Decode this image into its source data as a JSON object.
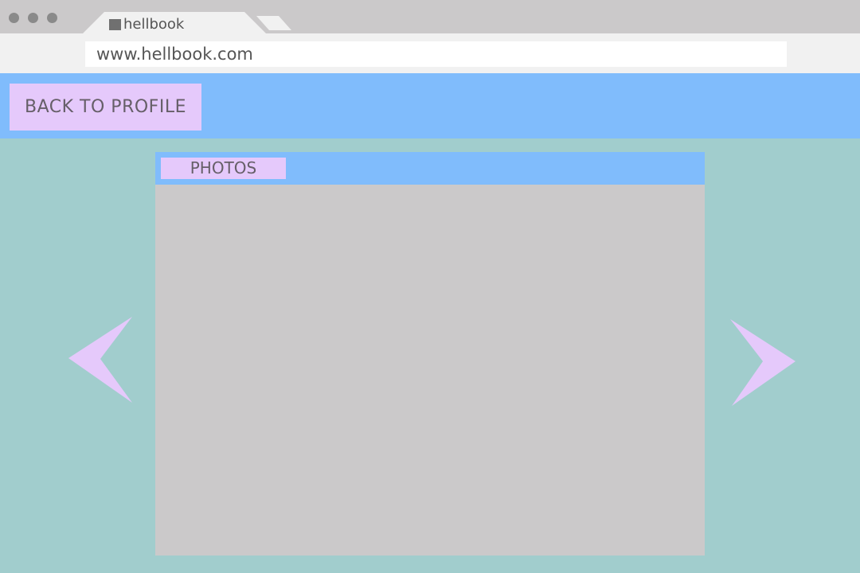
{
  "browser": {
    "tab_title": "hellbook",
    "url": "www.hellbook.com"
  },
  "header": {
    "back_label": "BACK TO PROFILE"
  },
  "photos_panel": {
    "tab_label": "PHOTOS"
  },
  "icons": {
    "previous": "arrow-left-icon",
    "next": "arrow-right-icon",
    "favicon": "favicon-icon"
  },
  "colors": {
    "page_background": "#a1cdcd",
    "header_band": "#80bcfc",
    "button_fill": "#e5c9fb",
    "panel_fill": "#cbc9ca",
    "label_text": "#665f68"
  }
}
